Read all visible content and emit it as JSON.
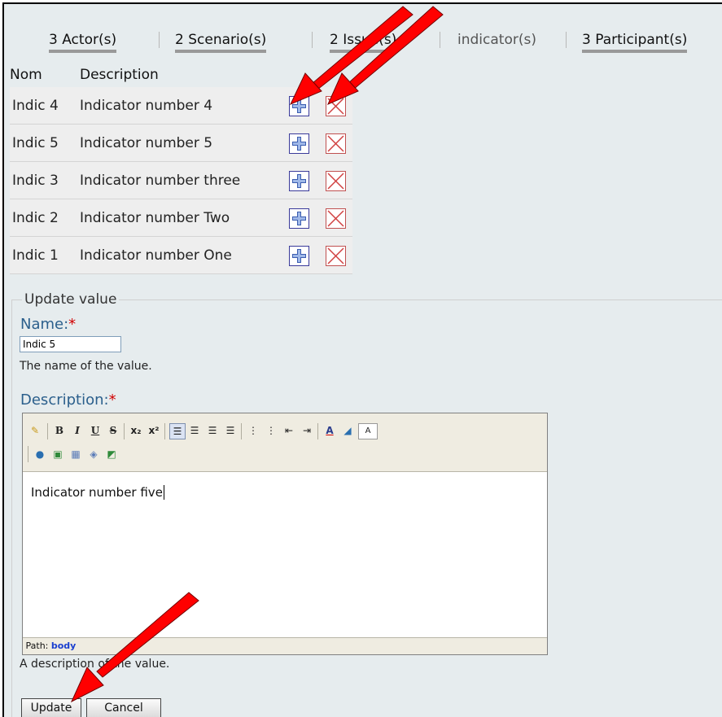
{
  "tabs": [
    {
      "label": "3 Actor(s)"
    },
    {
      "label": "2 Scenario(s)"
    },
    {
      "label": "2 Issue(s)"
    },
    {
      "label": "indicator(s)"
    },
    {
      "label": "3 Participant(s)"
    }
  ],
  "table": {
    "headers": {
      "nom": "Nom",
      "description": "Description"
    },
    "rows": [
      {
        "nom": "Indic 4",
        "description": "Indicator number 4"
      },
      {
        "nom": "Indic 5",
        "description": "Indicator number 5"
      },
      {
        "nom": "Indic 3",
        "description": "Indicator number three"
      },
      {
        "nom": "Indic 2",
        "description": "Indicator number Two"
      },
      {
        "nom": "Indic 1",
        "description": "Indicator number One"
      }
    ]
  },
  "form": {
    "legend": "Update value",
    "name": {
      "label": "Name:",
      "required": "*",
      "value": "Indic 5",
      "help": "The name of the value."
    },
    "description": {
      "label": "Description:",
      "required": "*",
      "value": "Indicator number five",
      "help": "A description of the value."
    },
    "path": {
      "label": "Path:",
      "value": "body"
    },
    "buttons": {
      "update": "Update",
      "cancel": "Cancel"
    }
  },
  "toolbar": {
    "icons": [
      "broom-icon",
      "bold-icon",
      "italic-icon",
      "underline-icon",
      "strikethrough-icon",
      "subscript-icon",
      "superscript-icon",
      "align-left-icon",
      "align-center-icon",
      "align-right-icon",
      "align-justify-icon",
      "ordered-list-icon",
      "unordered-list-icon",
      "outdent-icon",
      "indent-icon",
      "text-color-icon",
      "background-color-icon",
      "text-style-icon",
      "link-icon",
      "image-icon",
      "table-icon",
      "html-icon",
      "insert-icon"
    ]
  },
  "colors": {
    "accent": "#2b5f8c",
    "required": "#d10000",
    "arrow": "#e00000"
  }
}
